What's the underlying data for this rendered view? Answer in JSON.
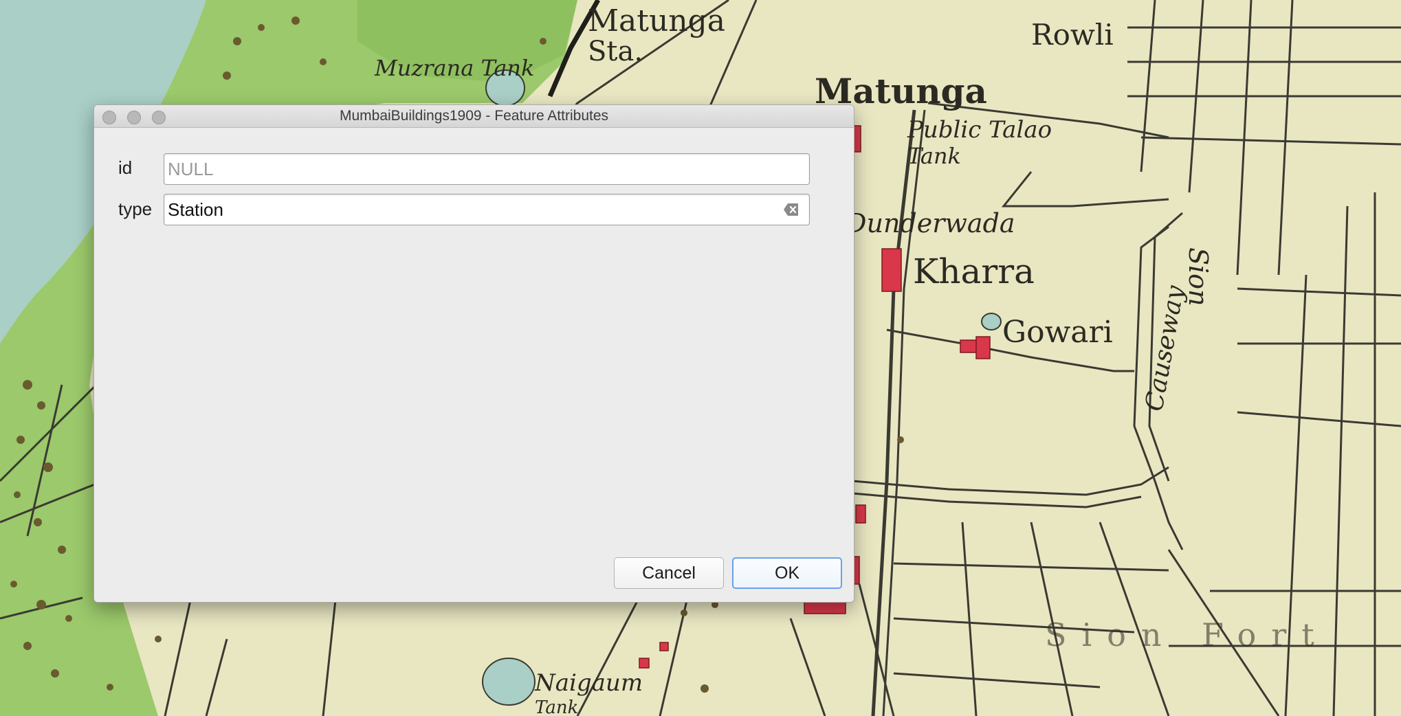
{
  "dialog": {
    "title": "MumbaiBuildings1909 - Feature Attributes",
    "fields": [
      {
        "label": "id",
        "value": "",
        "placeholder": "NULL"
      },
      {
        "label": "type",
        "value": "Station"
      }
    ],
    "buttons": {
      "cancel": "Cancel",
      "ok": "OK"
    }
  },
  "map": {
    "labels": [
      "Matunga",
      "Sta.",
      "Matunga",
      "Rowli",
      "Public Talao",
      "Tank",
      "Dunderwada",
      "Kharra",
      "Gowari",
      "Sion",
      "Causeway",
      "Muzrana Tank",
      "Naigaum",
      "Tank",
      "Sion Fort"
    ],
    "colors": {
      "paper": "#e9e6c2",
      "sea": "#a9cfc6",
      "green": "#9bc96b",
      "ink": "#3a3a32",
      "building": "#d9374a"
    }
  }
}
